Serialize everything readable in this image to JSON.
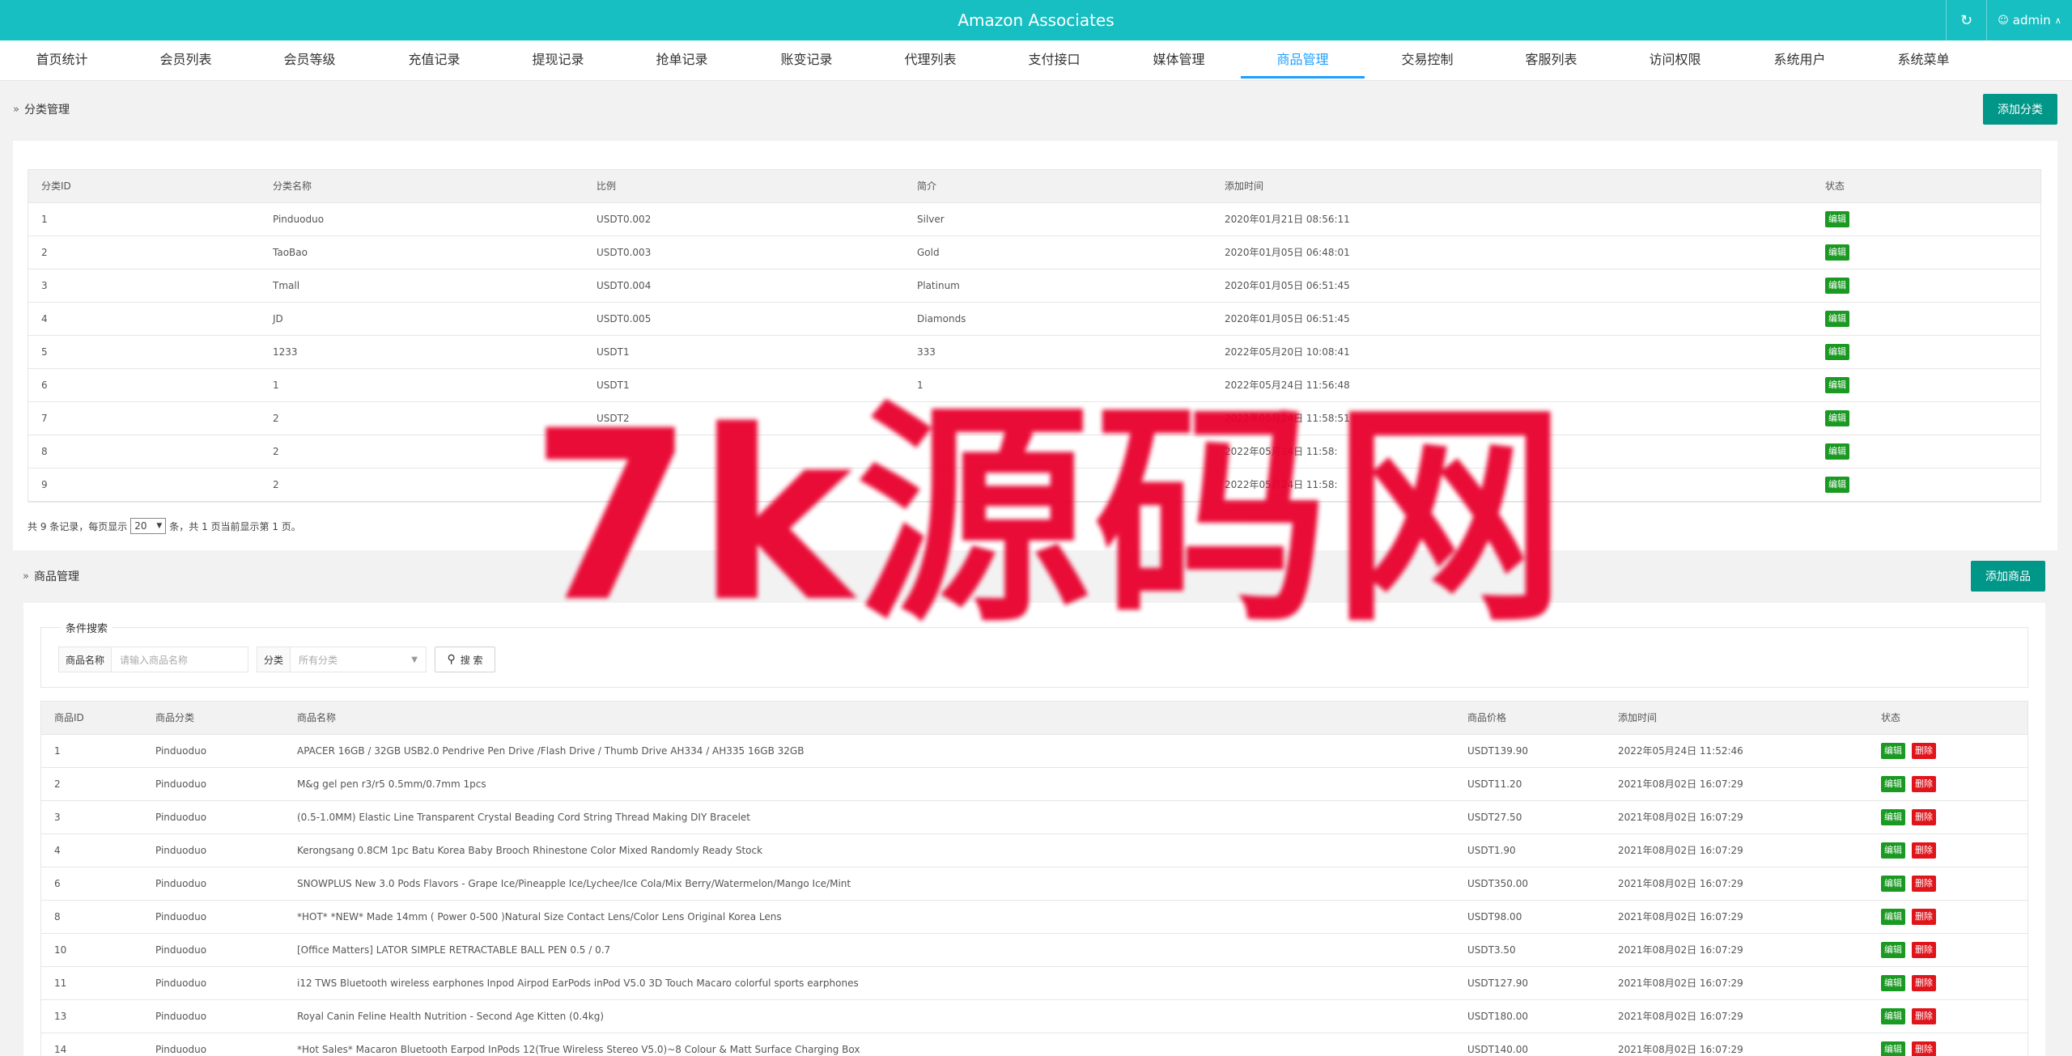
{
  "header": {
    "title": "Amazon Associates",
    "refresh_icon": "refresh-icon",
    "user_icon": "user-icon",
    "user": "admin",
    "user_caret": "^"
  },
  "nav": [
    "首页统计",
    "会员列表",
    "会员等级",
    "充值记录",
    "提现记录",
    "抢单记录",
    "账变记录",
    "代理列表",
    "支付接口",
    "媒体管理",
    "商品管理",
    "交易控制",
    "客服列表",
    "访问权限",
    "系统用户",
    "系统菜单"
  ],
  "nav_active": "商品管理",
  "category": {
    "title": "分类管理",
    "add_button": "添加分类",
    "columns": [
      "分类ID",
      "分类名称",
      "比例",
      "简介",
      "添加时间",
      "状态"
    ],
    "rows": [
      [
        "1",
        "Pinduoduo",
        "USDT0.002",
        "Silver",
        "2020年01月21日 08:56:11"
      ],
      [
        "2",
        "TaoBao",
        "USDT0.003",
        "Gold",
        "2020年01月05日 06:48:01"
      ],
      [
        "3",
        "Tmall",
        "USDT0.004",
        "Platinum",
        "2020年01月05日 06:51:45"
      ],
      [
        "4",
        "JD",
        "USDT0.005",
        "Diamonds",
        "2020年01月05日 06:51:45"
      ],
      [
        "5",
        "1233",
        "USDT1",
        "333",
        "2022年05月20日 10:08:41"
      ],
      [
        "6",
        "1",
        "USDT1",
        "1",
        "2022年05月24日 11:56:48"
      ],
      [
        "7",
        "2",
        "USDT2",
        "",
        "2022年05月24日 11:58:51"
      ],
      [
        "8",
        "2",
        "",
        "",
        "2022年05月24日 11:58:"
      ],
      [
        "9",
        "2",
        "",
        "",
        "2022年05月24日 11:58:"
      ]
    ],
    "edit_label": "编辑",
    "pager": {
      "prefix": "共 9 条记录，每页显示",
      "per_page": "20",
      "suffix": "条，共 1 页当前显示第 1 页。"
    }
  },
  "product": {
    "title": "商品管理",
    "add_button": "添加商品",
    "search": {
      "legend": "条件搜索",
      "name_label": "商品名称",
      "name_placeholder": "请输入商品名称",
      "cat_label": "分类",
      "cat_value": "所有分类",
      "search_label": "搜 索",
      "search_icon": "search-icon"
    },
    "columns": [
      "商品ID",
      "商品分类",
      "商品名称",
      "商品价格",
      "添加时间",
      "状态"
    ],
    "rows": [
      [
        "1",
        "Pinduoduo",
        "APACER 16GB / 32GB USB2.0 Pendrive Pen Drive /Flash Drive / Thumb Drive AH334 / AH335 16GB 32GB",
        "USDT139.90",
        "2022年05月24日 11:52:46"
      ],
      [
        "2",
        "Pinduoduo",
        "M&g gel pen r3/r5 0.5mm/0.7mm 1pcs",
        "USDT11.20",
        "2021年08月02日 16:07:29"
      ],
      [
        "3",
        "Pinduoduo",
        "(0.5-1.0MM) Elastic Line Transparent Crystal Beading Cord String Thread Making DIY Bracelet",
        "USDT27.50",
        "2021年08月02日 16:07:29"
      ],
      [
        "4",
        "Pinduoduo",
        "Kerongsang 0.8CM 1pc Batu Korea Baby Brooch Rhinestone Color Mixed Randomly Ready Stock",
        "USDT1.90",
        "2021年08月02日 16:07:29"
      ],
      [
        "6",
        "Pinduoduo",
        "SNOWPLUS New 3.0 Pods Flavors - Grape Ice/Pineapple Ice/Lychee/Ice Cola/Mix Berry/Watermelon/Mango Ice/Mint",
        "USDT350.00",
        "2021年08月02日 16:07:29"
      ],
      [
        "8",
        "Pinduoduo",
        "*HOT* *NEW* Made 14mm ( Power 0-500 )Natural Size Contact Lens/Color Lens Original Korea Lens",
        "USDT98.00",
        "2021年08月02日 16:07:29"
      ],
      [
        "10",
        "Pinduoduo",
        "[Office Matters] LATOR SIMPLE RETRACTABLE BALL PEN 0.5 / 0.7",
        "USDT3.50",
        "2021年08月02日 16:07:29"
      ],
      [
        "11",
        "Pinduoduo",
        "i12 TWS Bluetooth wireless earphones Inpod Airpod EarPods inPod V5.0 3D Touch Macaro colorful sports earphones",
        "USDT127.90",
        "2021年08月02日 16:07:29"
      ],
      [
        "13",
        "Pinduoduo",
        "Royal Canin Feline Health Nutrition - Second Age Kitten (0.4kg)",
        "USDT180.00",
        "2021年08月02日 16:07:29"
      ],
      [
        "14",
        "Pinduoduo",
        "*Hot Sales* Macaron Bluetooth Earpod InPods 12(True Wireless Stereo V5.0)~8 Colour & Matt Surface Charging Box",
        "USDT140.00",
        "2021年08月02日 16:07:29"
      ]
    ],
    "edit_label": "编辑",
    "delete_label": "删除"
  },
  "watermark": "7k源码网",
  "colors": {
    "header": "#17bfc2",
    "teal_button": "#009688",
    "active_nav": "#1e9fff",
    "edit_tag": "#1a9a22",
    "delete_tag": "#e0141b",
    "watermark": "#e8002d"
  }
}
